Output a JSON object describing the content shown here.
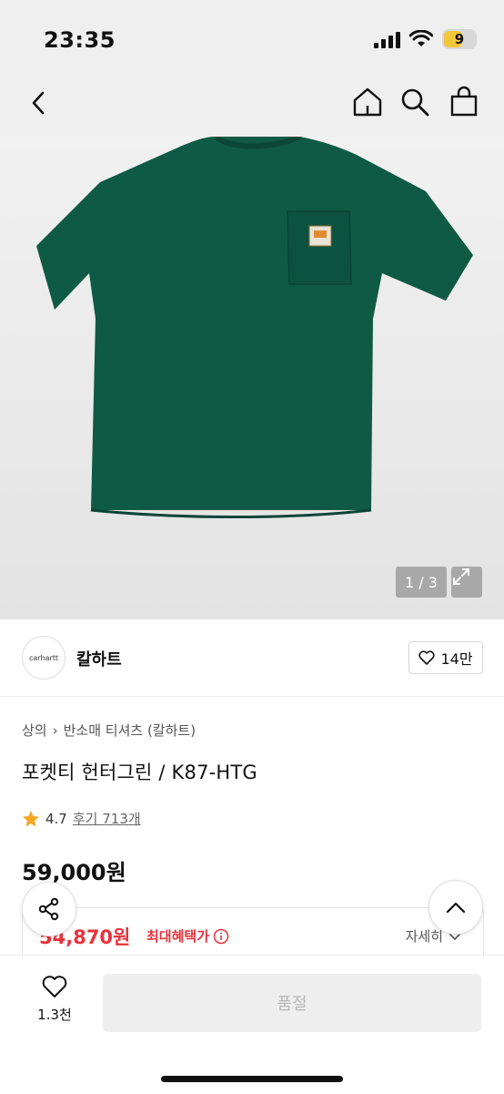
{
  "status": {
    "time": "23:35",
    "battery": "9"
  },
  "nav": {
    "back_icon": "chevron-left-icon",
    "home_icon": "home-icon",
    "search_icon": "search-icon",
    "bag_icon": "shopping-bag-icon"
  },
  "gallery": {
    "pager": "1 / 3",
    "product_color": "#0f5a44"
  },
  "brand": {
    "logo_text": "carhartt",
    "name": "칼하트",
    "likes": "14만"
  },
  "product": {
    "breadcrumb": [
      "상의",
      "반소매 티셔츠 (칼하트)"
    ],
    "title": "포켓티 헌터그린 / K87-HTG",
    "rating": "4.7",
    "reviews": "후기 713개",
    "price": "59,000원"
  },
  "benefit": {
    "price": "54,870원",
    "label": "최대혜택가",
    "detail": "자세히"
  },
  "bottom": {
    "wish_count": "1.3천",
    "cta": "품절"
  },
  "colors": {
    "accent_red": "#e8323c",
    "star": "#f5a623"
  }
}
